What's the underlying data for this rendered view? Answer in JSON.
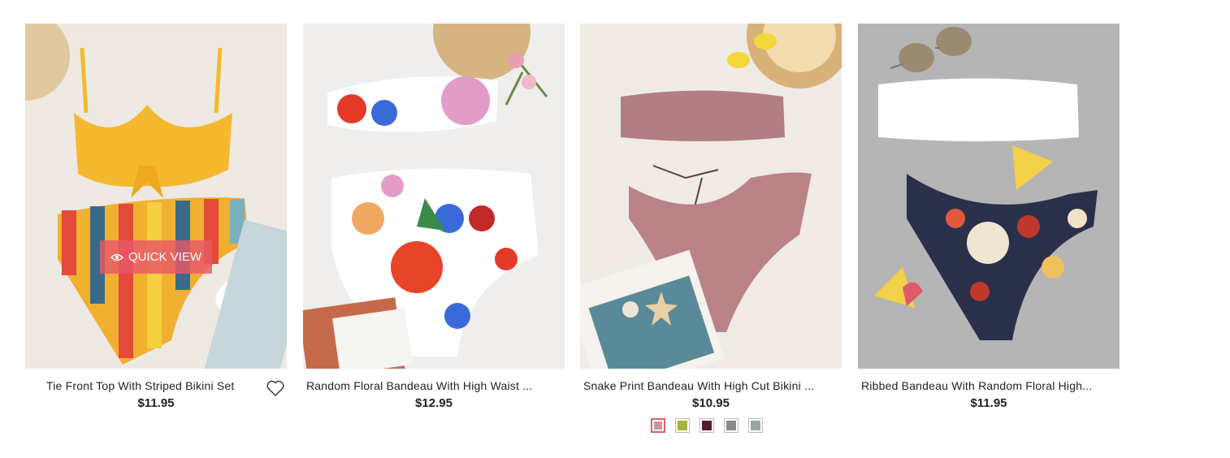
{
  "products": [
    {
      "title": "Tie Front Top With Striped Bikini Set",
      "price": "$11.95"
    },
    {
      "title": "Random Floral Bandeau With High Waist ...",
      "price": "$12.95"
    },
    {
      "title": "Snake Print Bandeau With High Cut Bikini ...",
      "price": "$10.95"
    },
    {
      "title": "Ribbed Bandeau With Random Floral High...",
      "price": "$11.95"
    }
  ],
  "quick_view": {
    "label": "QUICK VIEW",
    "icon": "eye-icon"
  },
  "wishlist": {
    "icon": "heart-icon"
  },
  "swatch_colors": [
    "#c49a9e",
    "#a9b23a",
    "#5a1a2a",
    "#8c8c8c",
    "#9aa5a8"
  ],
  "accent": "#e05c6a"
}
